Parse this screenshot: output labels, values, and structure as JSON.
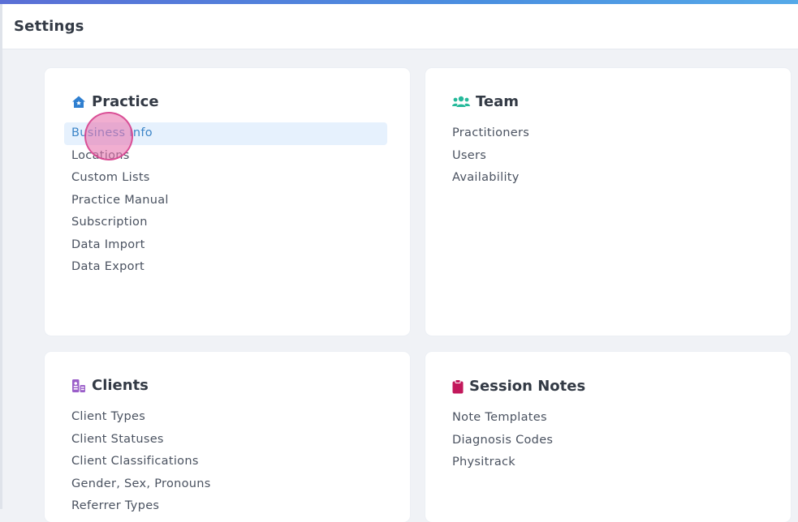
{
  "header": {
    "title": "Settings"
  },
  "cards": {
    "practice": {
      "title": "Practice",
      "items": [
        "Business Info",
        "Locations",
        "Custom Lists",
        "Practice Manual",
        "Subscription",
        "Data Import",
        "Data Export"
      ]
    },
    "team": {
      "title": "Team",
      "items": [
        "Practitioners",
        "Users",
        "Availability"
      ]
    },
    "clients": {
      "title": "Clients",
      "items": [
        "Client Types",
        "Client Statuses",
        "Client Classifications",
        "Gender, Sex, Pronouns",
        "Referrer Types"
      ]
    },
    "session_notes": {
      "title": "Session Notes",
      "items": [
        "Note Templates",
        "Diagnosis Codes",
        "Physitrack"
      ]
    }
  },
  "colors": {
    "practice_icon": "#2f7fd0",
    "team_icon": "#25b99a",
    "clients_icon": "#9b5fc9",
    "session_notes_icon": "#c2185b",
    "active_item_bg": "#e6f1fd",
    "active_item_text": "#3d86c8"
  },
  "icons": {
    "practice": "house-icon",
    "team": "users-icon",
    "clients": "id-card-icon",
    "session_notes": "clipboard-icon"
  }
}
